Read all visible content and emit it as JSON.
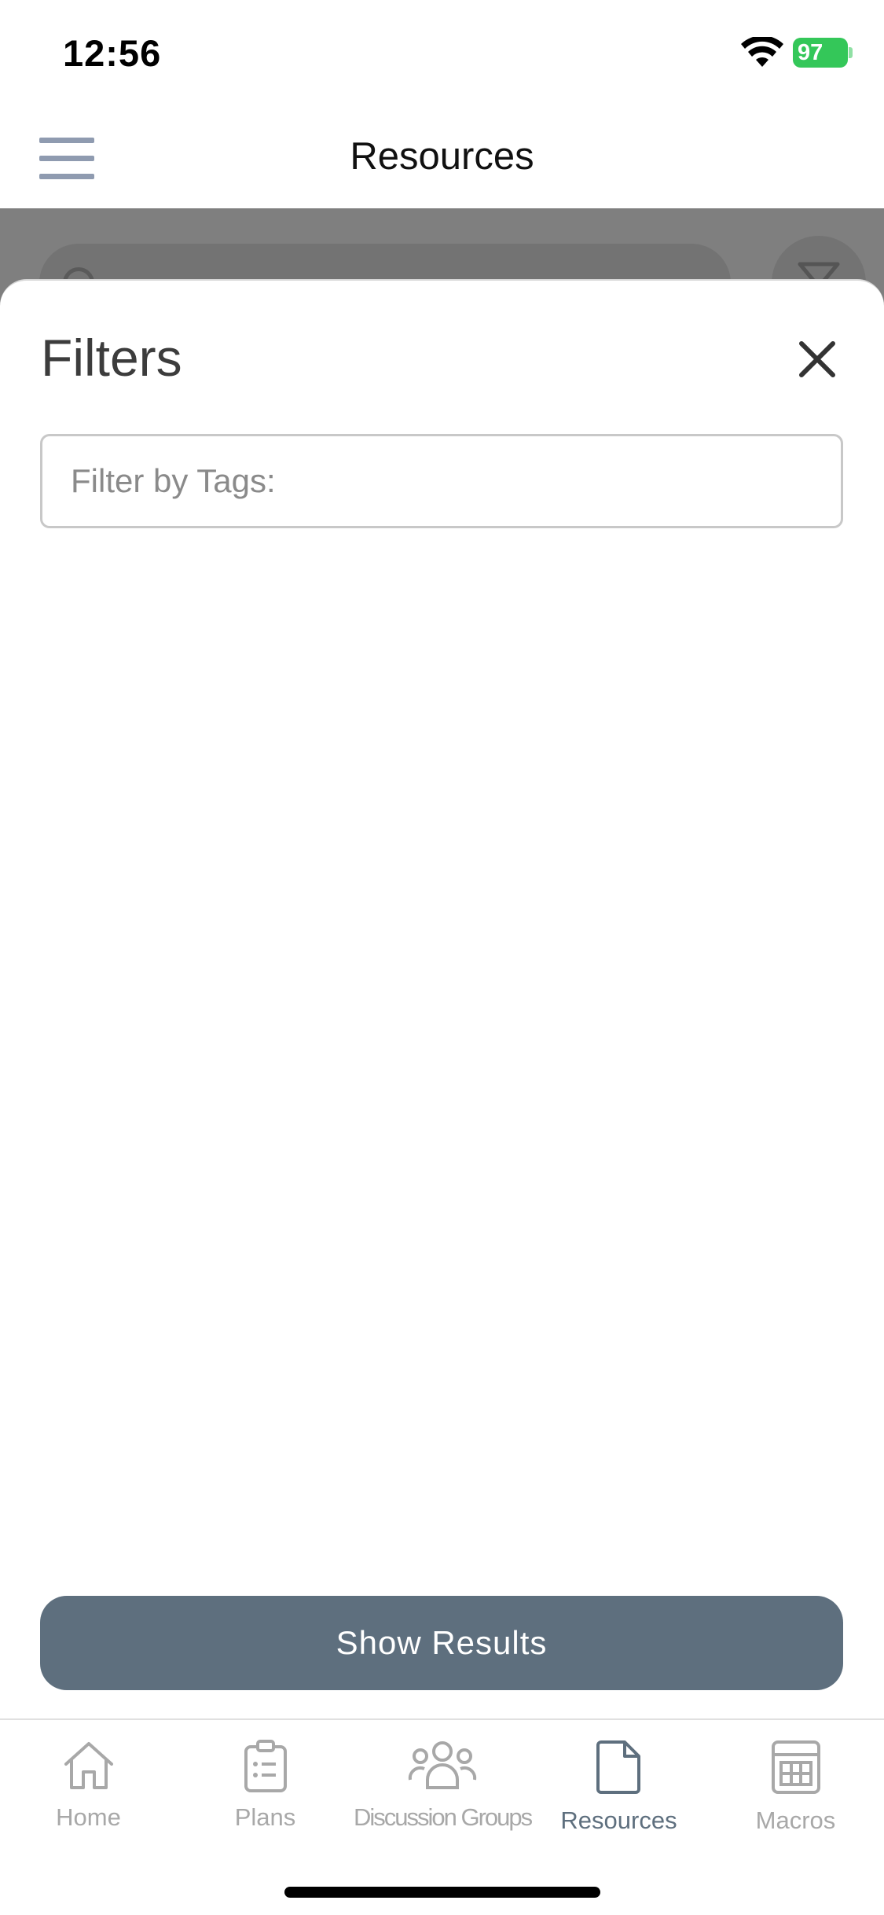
{
  "status": {
    "time": "12:56",
    "battery": "97"
  },
  "nav": {
    "title": "Resources"
  },
  "filters": {
    "title": "Filters",
    "tags_placeholder": "Filter by Tags:",
    "tags_value": "",
    "show_results_label": "Show Results"
  },
  "tabs": [
    {
      "label": "Home",
      "icon": "home-icon",
      "active": false
    },
    {
      "label": "Plans",
      "icon": "clipboard-icon",
      "active": false
    },
    {
      "label": "Discussion Groups",
      "icon": "group-icon",
      "active": false
    },
    {
      "label": "Resources",
      "icon": "document-icon",
      "active": true
    },
    {
      "label": "Macros",
      "icon": "calculator-icon",
      "active": false
    }
  ],
  "colors": {
    "accent": "#5e6f7e",
    "inactive_tab": "#a8a8a8",
    "menu_icon": "#8f9bb0",
    "battery": "#34c759"
  }
}
